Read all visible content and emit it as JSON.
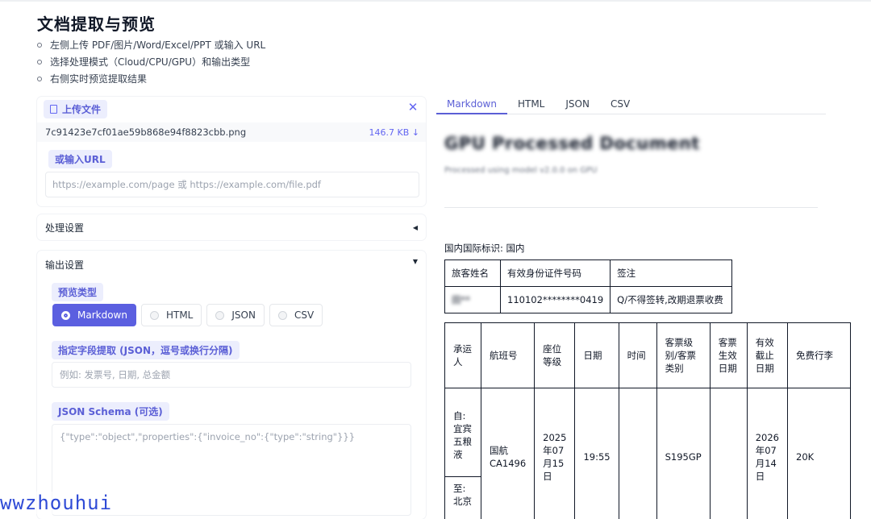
{
  "page": {
    "title": "文档提取与预览",
    "bullets": [
      "左侧上传 PDF/图片/Word/Excel/PPT 或输入 URL",
      "选择处理模式（Cloud/CPU/GPU）和输出类型",
      "右侧实时预览提取结果"
    ]
  },
  "upload": {
    "label": "上传文件",
    "close": "✕",
    "file_name": "7c91423e7cf01ae59b868e94f8823cbb.png",
    "file_size": "146.7 KB ↓",
    "url_label": "或输入URL",
    "url_placeholder": "https://example.com/page 或 https://example.com/file.pdf"
  },
  "processing": {
    "label": "处理设置",
    "arrow": "◀"
  },
  "output": {
    "label": "输出设置",
    "arrow": "▼",
    "preview_type_label": "预览类型",
    "options": [
      "Markdown",
      "HTML",
      "JSON",
      "CSV"
    ],
    "selected": "Markdown",
    "fields_label": "指定字段提取 (JSON，逗号或换行分隔)",
    "fields_placeholder": "例如: 发票号, 日期, 总金额",
    "schema_label": "JSON Schema (可选)",
    "schema_placeholder": "{\"type\":\"object\",\"properties\":{\"invoice_no\":{\"type\":\"string\"}}}"
  },
  "tabs": [
    "Markdown",
    "HTML",
    "JSON",
    "CSV"
  ],
  "active_tab": "Markdown",
  "preview": {
    "title": "GPU Processed Document",
    "subtitle": "Processed using model v2.0.0 on GPU",
    "intl_flag": "国内国际标识: 国内",
    "passenger_table": {
      "headers": [
        "旅客姓名",
        "有效身份证件号码",
        "签注"
      ],
      "row": [
        "田**",
        "110102********0419",
        "Q/不得签转,改期退票收费"
      ]
    },
    "flight_table": {
      "headers": [
        "承运人",
        "航班号",
        "座位等级",
        "日期",
        "时间",
        "客票级别/客票类别",
        "客票生效日期",
        "有效截止日期",
        "免费行李"
      ],
      "from": "自: 宜宾五粮液",
      "to": "至: 北京",
      "cells": [
        "国航CA1496",
        "2025年07月15日",
        "19:55",
        "",
        "S195GP",
        "",
        "2026年07月14日",
        "20K"
      ]
    }
  },
  "watermark": "wwzhouhui"
}
